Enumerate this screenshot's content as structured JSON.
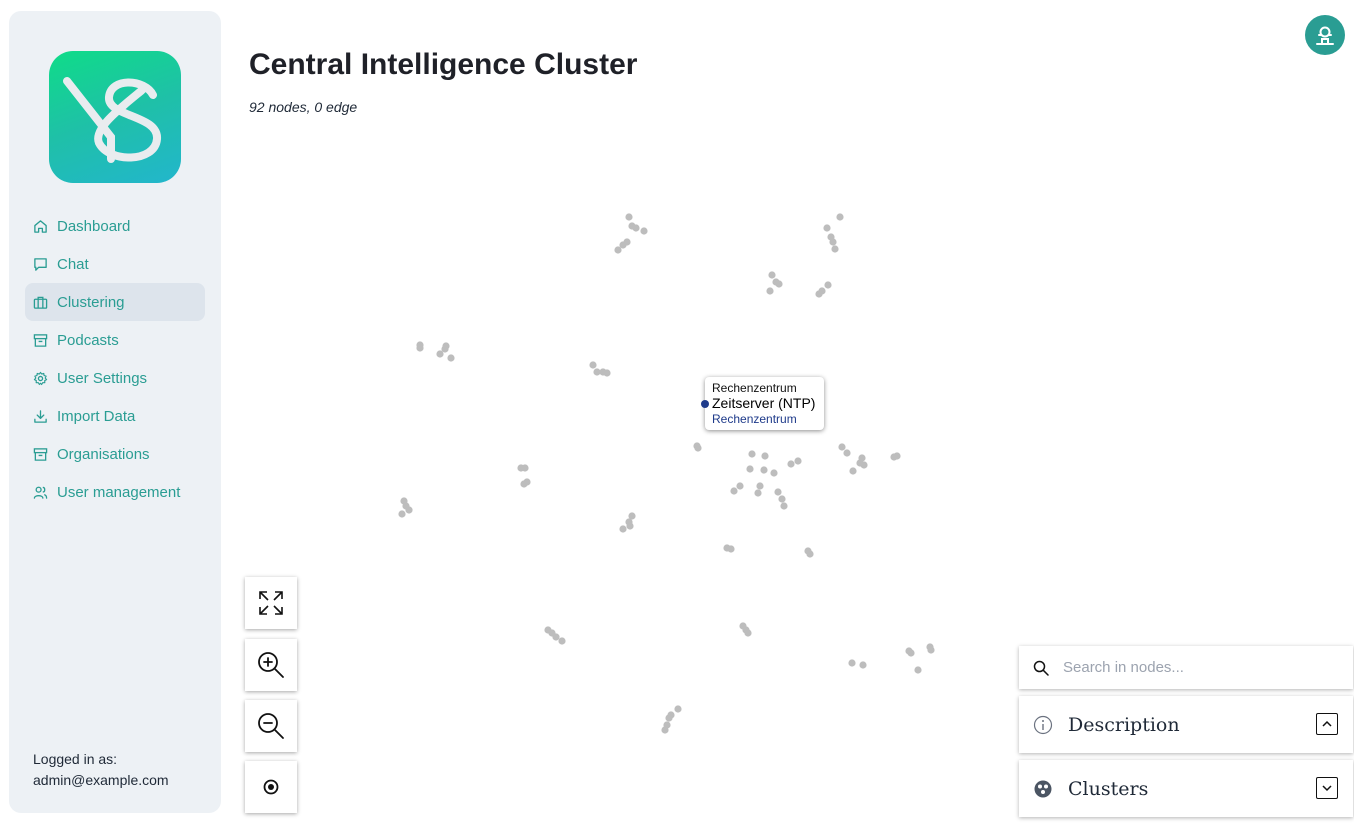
{
  "app": {
    "logo_name": "YS logo",
    "accent_color": "#2a9d93"
  },
  "sidebar": {
    "items": [
      {
        "label": "Dashboard",
        "icon": "home-icon"
      },
      {
        "label": "Chat",
        "icon": "chat-icon"
      },
      {
        "label": "Clustering",
        "icon": "briefcase-icon",
        "active": true
      },
      {
        "label": "Podcasts",
        "icon": "archive-icon"
      },
      {
        "label": "User Settings",
        "icon": "gear-icon"
      },
      {
        "label": "Import Data",
        "icon": "download-icon"
      },
      {
        "label": "Organisations",
        "icon": "archive-icon"
      },
      {
        "label": "User management",
        "icon": "users-icon"
      }
    ],
    "logged_in_label": "Logged in as:",
    "logged_in_user": "admin@example.com"
  },
  "header": {
    "title": "Central Intelligence Cluster",
    "stats": "92 nodes, 0 edge"
  },
  "graph": {
    "node_color": "#bdbdbd",
    "highlight_color": "#1e3a8a",
    "tooltip": {
      "category": "Rechenzentrum",
      "label": "Zeitserver (NTP)",
      "cluster": "Rechenzentrum"
    }
  },
  "controls": {
    "fullscreen": "fullscreen-icon",
    "zoom_in": "zoom-in-icon",
    "zoom_out": "zoom-out-icon",
    "reset": "target-icon"
  },
  "panels": {
    "search_placeholder": "Search in nodes...",
    "description_title": "Description",
    "clusters_title": "Clusters"
  }
}
